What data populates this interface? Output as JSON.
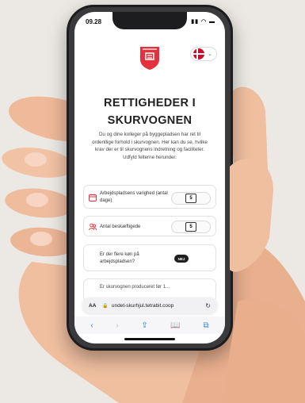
{
  "status_bar": {
    "time": "09.28",
    "icons": "▮▮ ◠ ▬"
  },
  "language": {
    "selected_flag": "danish-flag-icon",
    "chevron": "⌄"
  },
  "page": {
    "title_line1": "RETTIGHEDER I",
    "title_line2": "SKURVOGNEN",
    "intro": "Du og dine kolleger på byggepladsen har ret til ordentlige forhold i skurvognen. Her kan du se, hvilke krav der er til skurvognens indretning og faciliteter. Udfyld felterne herunder."
  },
  "fields": [
    {
      "label": "Arbejdspladsens varighed (antal dage)",
      "value": "5",
      "icon": "calendar-icon"
    },
    {
      "label": "Antal beskæftigede",
      "value": "5",
      "icon": "people-icon"
    },
    {
      "label": "Er der flere køn på arbejdspladsen?",
      "toggle": "NEJ"
    },
    {
      "label": "Er skurvognen produceret før 1..."
    }
  ],
  "browser": {
    "aa": "AA",
    "url": "undet-skurhjul.tetrabit.coop",
    "lock": "🔒",
    "reload": "↻",
    "toolbar": {
      "back": "‹",
      "forward": "›",
      "share": "⇪",
      "bookmarks": "📖",
      "tabs": "⧉"
    }
  },
  "colors": {
    "brand_red": "#e3323d",
    "toggle_dark": "#1f1f1f",
    "link_blue": "#2f7de1"
  }
}
